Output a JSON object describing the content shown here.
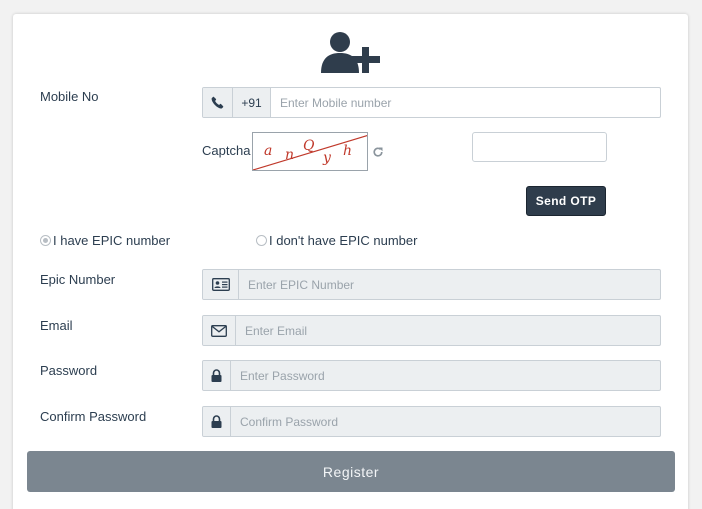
{
  "form": {
    "mobile_label": "Mobile No",
    "country_code": "+91",
    "mobile_placeholder": "Enter Mobile number",
    "captcha_label": "Captcha",
    "captcha_chars": [
      "a",
      "n",
      "Q",
      "y",
      "h"
    ],
    "captcha_input_value": "",
    "send_otp_label": "Send OTP",
    "radio_epic_yes": "I have EPIC number",
    "radio_epic_no": "I don't have EPIC number",
    "epic_label": "Epic Number",
    "epic_placeholder": "Enter EPIC Number",
    "email_label": "Email",
    "email_placeholder": "Enter Email",
    "password_label": "Password",
    "password_placeholder": "Enter Password",
    "confirm_label": "Confirm Password",
    "confirm_placeholder": "Confirm Password",
    "register_label": "Register"
  },
  "icons": {
    "header": "add-user-icon",
    "mobile": "phone-icon",
    "captcha_refresh": "refresh-icon",
    "epic": "id-card-icon",
    "email": "envelope-icon",
    "password": "lock-icon"
  },
  "colors": {
    "primary_dark": "#2f3d4c",
    "register_button": "#7b8690",
    "captcha_text": "#c0392b"
  }
}
